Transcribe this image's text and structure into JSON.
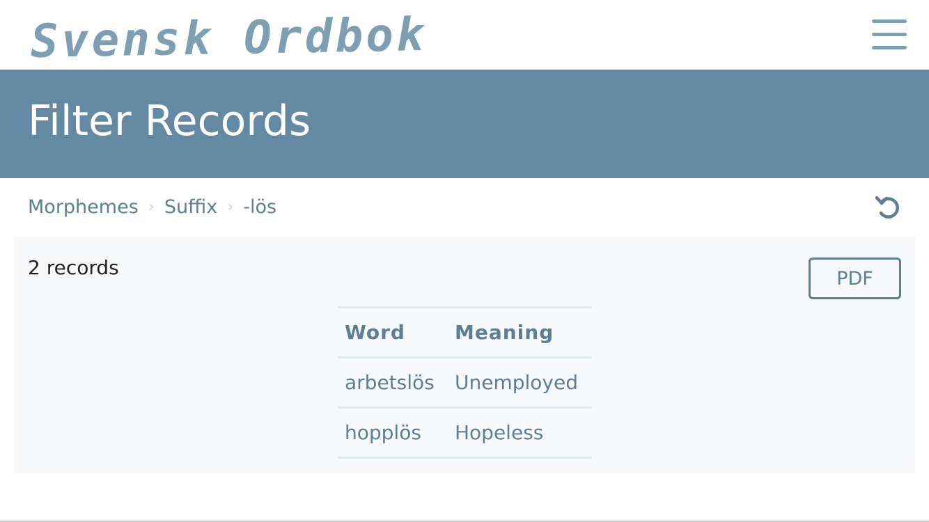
{
  "header": {
    "logo_text": "Svensk Ordbok",
    "menu_icon": "hamburger-menu-icon"
  },
  "banner": {
    "title": "Filter Records"
  },
  "breadcrumb": {
    "items": [
      "Morphemes",
      "Suffix",
      "-lös"
    ],
    "separator_icon": "chevron-right-icon"
  },
  "toolbar": {
    "reset_icon": "reset-icon"
  },
  "results": {
    "count_label": "2 records",
    "pdf_label": "PDF",
    "columns": [
      "Word",
      "Meaning"
    ],
    "rows": [
      [
        "arbetslös",
        "Unemployed"
      ],
      [
        "hopplös",
        "Hopeless"
      ]
    ]
  },
  "colors": {
    "accent": "#6489a2",
    "link": "#5b7f96",
    "logo": "#7d9fb3",
    "panel_bg": "#f6f8fa"
  }
}
